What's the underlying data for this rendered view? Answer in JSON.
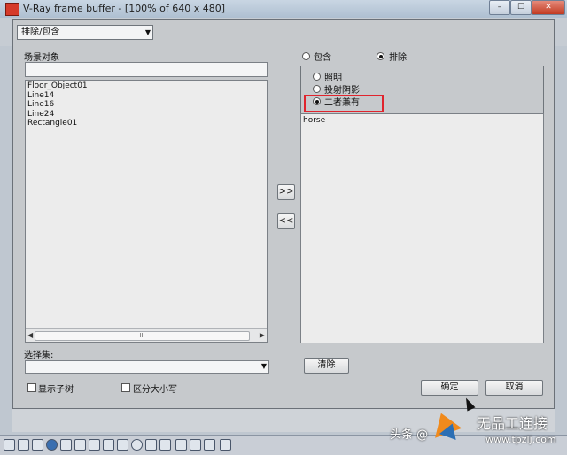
{
  "window": {
    "title": "V-Ray frame buffer - [100% of 640 x 480]",
    "min_label": "–",
    "max_label": "☐",
    "close_label": "✕"
  },
  "dialog": {
    "mode_combo": "排除/包含",
    "scene_objects_label": "场景对象",
    "scene_filter_value": "",
    "scene_objects": [
      "Floor_Object01",
      "Line14",
      "Line16",
      "Line24",
      "Rectangle01"
    ],
    "scroll_thumb": "III",
    "add_button": ">>",
    "remove_button": "<<",
    "include_label": "包含",
    "exclude_label": "排除",
    "include_selected": false,
    "exclude_selected": true,
    "type_options": [
      "照明",
      "投射阴影",
      "二者兼有"
    ],
    "type_selected_index": 2,
    "excluded_objects": [
      "horse"
    ],
    "selection_set_label": "选择集:",
    "selection_set_value": "",
    "clear_button": "清除",
    "show_subtree_label": "显示子树",
    "show_subtree_checked": false,
    "case_sensitive_label": "区分大小写",
    "case_sensitive_checked": false,
    "ok_button": "确定",
    "cancel_button": "取消"
  },
  "watermark": {
    "left_text": "头条 @",
    "brand_text": "无品工连接",
    "url_text": "www.tpzlj.com"
  },
  "colors": {
    "highlight": "#e0242d",
    "dialog_bg": "#c6c9cc",
    "close_button": "#c23b22"
  }
}
